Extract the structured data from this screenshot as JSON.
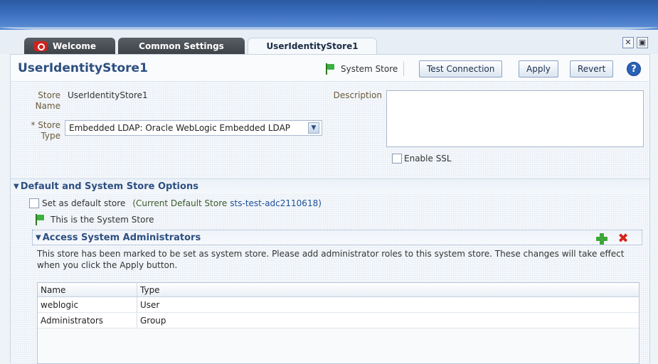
{
  "tabs": [
    {
      "label": "Welcome"
    },
    {
      "label": "Common Settings"
    },
    {
      "label": "UserIdentityStore1"
    }
  ],
  "header": {
    "title": "UserIdentityStore1",
    "system_store_label": "System Store",
    "test_connection_label": "Test Connection",
    "apply_label": "Apply",
    "revert_label": "Revert",
    "help_label": "?"
  },
  "form": {
    "store_name_label_1": "Store",
    "store_name_label_2": "Name",
    "store_name_value": "UserIdentityStore1",
    "store_type_label_1": "* Store",
    "store_type_label_2": "Type",
    "store_type_value": "Embedded LDAP: Oracle WebLogic Embedded LDAP",
    "description_label": "Description",
    "description_value": "",
    "enable_ssl_label": "Enable SSL"
  },
  "default_section": {
    "title": "Default and System Store Options",
    "set_default_label": "Set as default store",
    "current_default_prefix": "(Current Default Store",
    "current_default_value": "sts-test-adc2110618)",
    "system_store_note": "This is the System Store"
  },
  "admins_section": {
    "title": "Access System Administrators",
    "note": "This store has been marked to be set as system store. Please add administrator roles to this system store. These changes will take effect when you click the Apply button.",
    "columns": [
      "Name",
      "Type"
    ],
    "rows": [
      {
        "name": "weblogic",
        "type": "User"
      },
      {
        "name": "Administrators",
        "type": "Group"
      }
    ]
  },
  "colors": {
    "banner": "#3a6fbf",
    "title": "#2d4f80",
    "add_icon": "#3ea53a",
    "delete_icon": "#d8231b"
  }
}
